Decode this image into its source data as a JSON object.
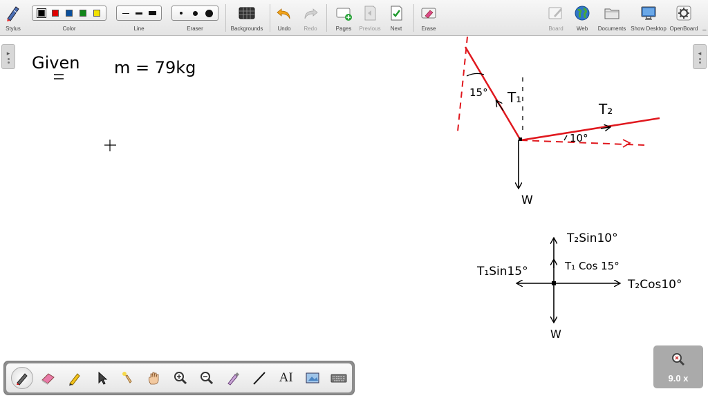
{
  "toolbar": {
    "stylus": "Stylus",
    "color": "Color",
    "line": "Line",
    "eraser": "Eraser",
    "backgrounds": "Backgrounds",
    "undo": "Undo",
    "redo": "Redo",
    "pages": "Pages",
    "previous": "Previous",
    "next": "Next",
    "erase": "Erase",
    "board": "Board",
    "web": "Web",
    "documents": "Documents",
    "show_desktop": "Show Desktop",
    "openboard": "OpenBoard",
    "close": "−"
  },
  "colors": {
    "swatches": [
      "#000000",
      "#e00000",
      "#0a4f9c",
      "#12861a",
      "#f2e200"
    ],
    "accent_red": "#e0181e",
    "ink": "#000000"
  },
  "palette": {
    "tools": [
      "pen-icon",
      "eraser-icon",
      "highlighter-icon",
      "selector-icon",
      "laser-pointer-icon",
      "hand-icon",
      "zoom-in-icon",
      "zoom-out-icon",
      "pointer-pen-icon",
      "line-icon",
      "text-icon",
      "capture-icon",
      "keyboard-icon"
    ],
    "text_tool_label": "AI"
  },
  "zoom": {
    "value": "9.0 x"
  },
  "board": {
    "given": "Given",
    "mass": "m = 79kg",
    "angle_15": "15°",
    "t1": "T₁",
    "t2": "T₂",
    "angle_10": "10°",
    "w_top": "W",
    "fbd_t2sin": "T₂Sin10°",
    "fbd_t1cos": "T₁ Cos 15°",
    "fbd_t1sin": "T₁Sin15°",
    "fbd_t2cos": "T₂Cos10°",
    "w_bottom": "W"
  }
}
